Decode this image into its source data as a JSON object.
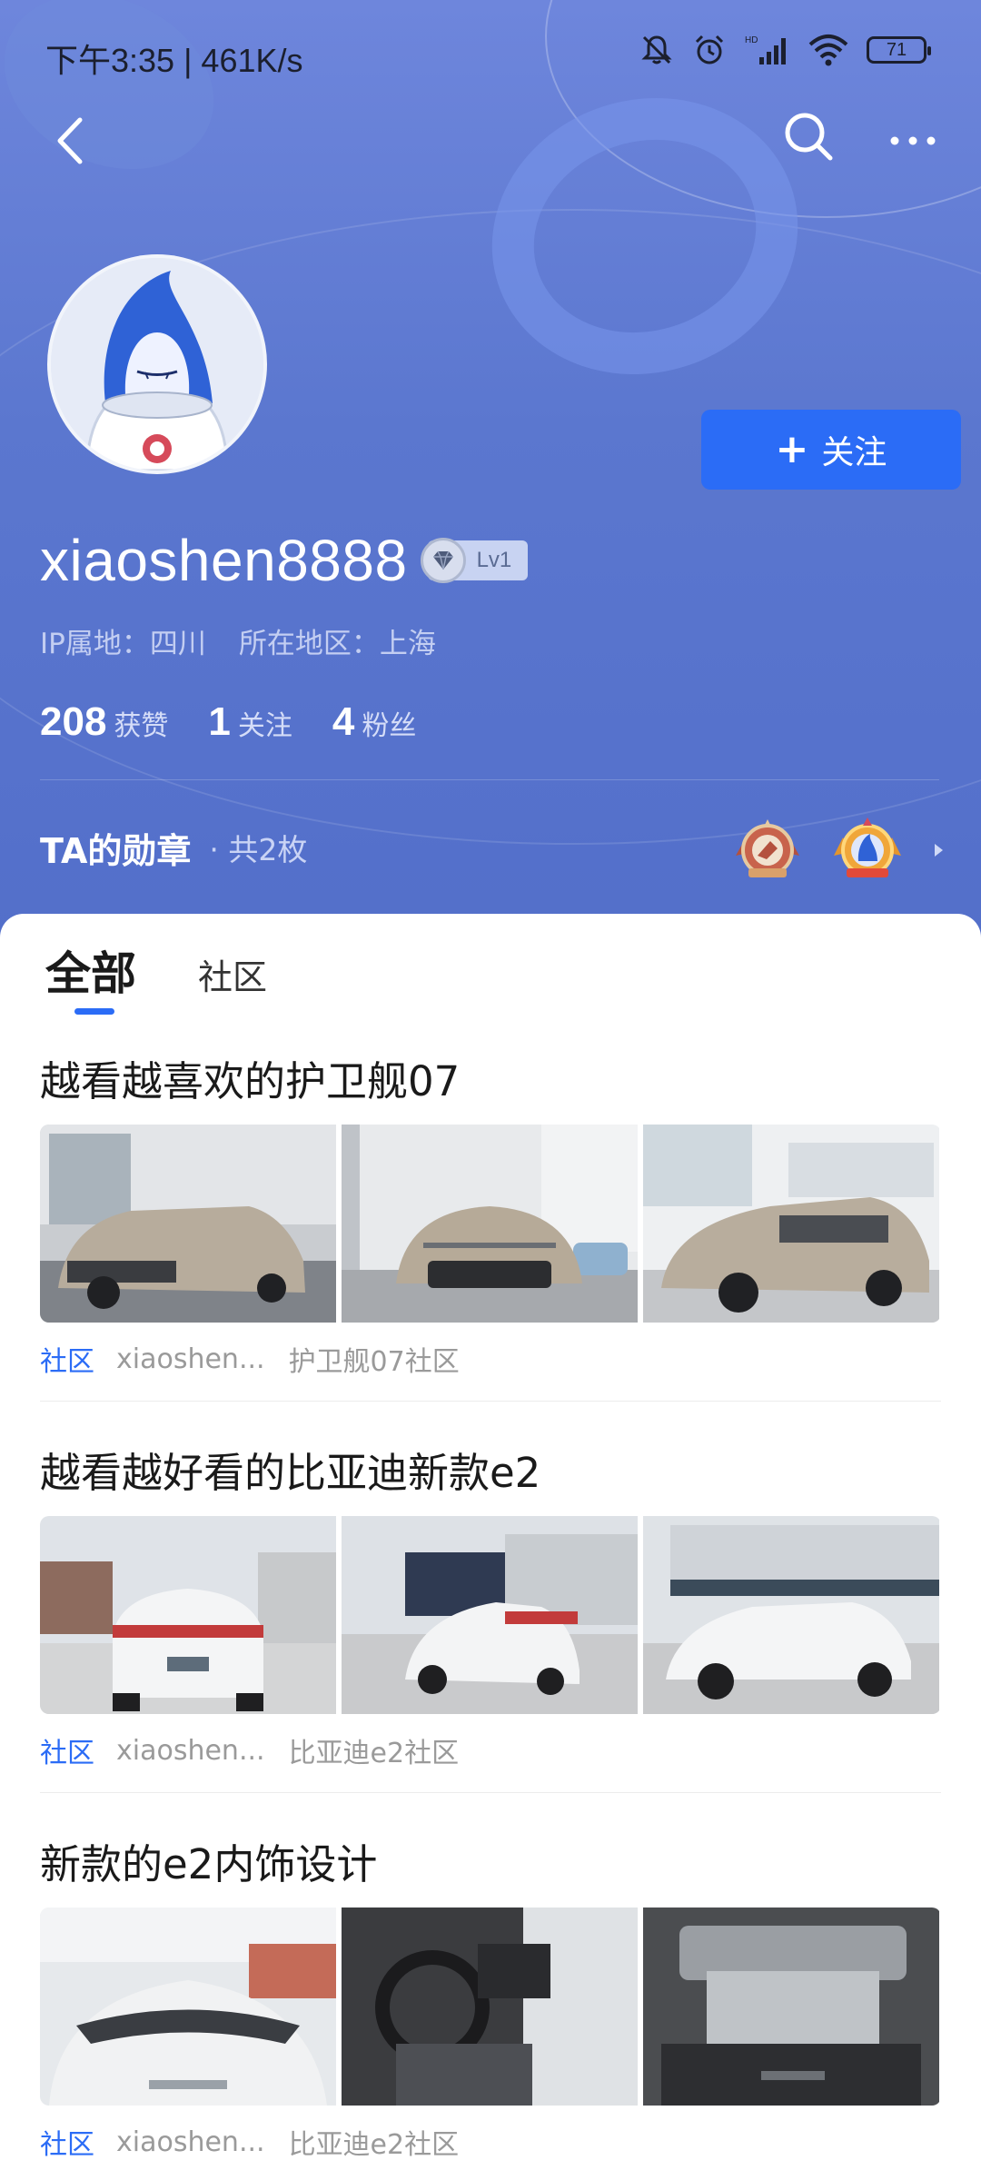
{
  "status_bar": {
    "time": "下午3:35 | 461K/s",
    "battery": "71"
  },
  "profile": {
    "username": "xiaoshen8888",
    "level": "Lv1",
    "ip_location": "IP属地：四川",
    "region": "所在地区：上海",
    "follow_button": "关注",
    "stats": [
      {
        "num": "208",
        "label": "获赞"
      },
      {
        "num": "1",
        "label": "关注"
      },
      {
        "num": "4",
        "label": "粉丝"
      }
    ],
    "medals_title": "TA的勋章",
    "medals_count": "· 共2枚"
  },
  "tabs": {
    "all": "全部",
    "community": "社区"
  },
  "posts": [
    {
      "title": "越看越喜欢的护卫舰07",
      "tag": "社区",
      "author": "xiaoshen...",
      "forum": "护卫舰07社区"
    },
    {
      "title": "越看越好看的比亚迪新款e2",
      "tag": "社区",
      "author": "xiaoshen...",
      "forum": "比亚迪e2社区"
    },
    {
      "title": "新款的e2内饰设计",
      "tag": "社区",
      "author": "xiaoshen...",
      "forum": "比亚迪e2社区"
    }
  ],
  "colors": {
    "header_blue": "#5b77cf",
    "accent": "#2b6cf6"
  }
}
